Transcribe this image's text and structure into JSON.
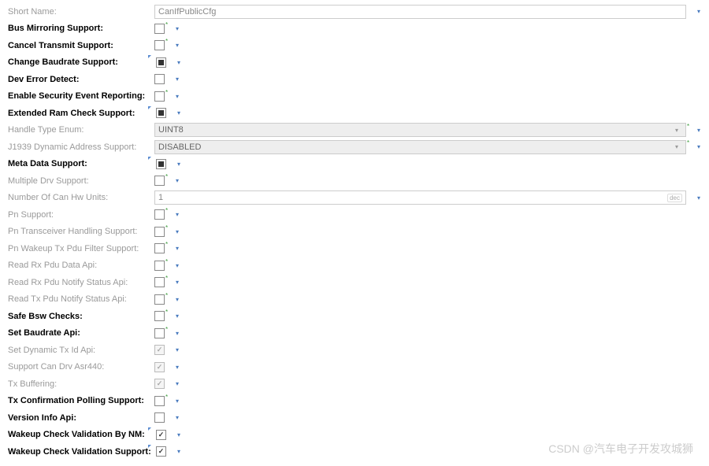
{
  "rows": [
    {
      "label": "Short Name:",
      "style": "muted",
      "type": "text",
      "value": "CanIfPublicCfg",
      "mark": "",
      "dd": true
    },
    {
      "label": "Bus Mirroring Support:",
      "style": "bold",
      "type": "chk",
      "state": "",
      "mark": "*",
      "dd": true
    },
    {
      "label": "Cancel Transmit Support:",
      "style": "bold",
      "type": "chk",
      "state": "",
      "mark": "*",
      "dd": true
    },
    {
      "label": "Change Baudrate Support:",
      "style": "bold",
      "type": "chk",
      "state": "partial",
      "mark": "",
      "corner": true,
      "dd": true
    },
    {
      "label": "Dev Error Detect:",
      "style": "bold",
      "type": "chk",
      "state": "",
      "mark": "",
      "dd": true
    },
    {
      "label": "Enable Security Event Reporting:",
      "style": "bold",
      "type": "chk",
      "state": "",
      "mark": "*",
      "dd": true
    },
    {
      "label": "Extended Ram Check Support:",
      "style": "bold",
      "type": "chk",
      "state": "partial",
      "mark": "",
      "corner": true,
      "dd": true
    },
    {
      "label": "Handle Type Enum:",
      "style": "muted",
      "type": "select",
      "value": "UINT8",
      "mark": "*",
      "dd": true
    },
    {
      "label": "J1939 Dynamic Address Support:",
      "style": "muted",
      "type": "select",
      "value": "DISABLED",
      "mark": "*",
      "dd": true
    },
    {
      "label": "Meta Data Support:",
      "style": "bold",
      "type": "chk",
      "state": "partial",
      "mark": "",
      "corner": true,
      "dd": true
    },
    {
      "label": "Multiple Drv Support:",
      "style": "muted",
      "type": "chk",
      "state": "",
      "mark": "*",
      "dd": true
    },
    {
      "label": "Number Of Can Hw Units:",
      "style": "muted",
      "type": "num",
      "value": "1",
      "unit": "dec",
      "mark": "",
      "dd": true
    },
    {
      "label": "Pn Support:",
      "style": "muted",
      "type": "chk",
      "state": "",
      "mark": "*",
      "dd": true
    },
    {
      "label": "Pn Transceiver Handling Support:",
      "style": "muted",
      "type": "chk",
      "state": "",
      "mark": "*",
      "dd": true
    },
    {
      "label": "Pn Wakeup Tx Pdu Filter Support:",
      "style": "muted",
      "type": "chk",
      "state": "",
      "mark": "*",
      "dd": true
    },
    {
      "label": "Read Rx Pdu Data Api:",
      "style": "muted",
      "type": "chk",
      "state": "",
      "mark": "*",
      "dd": true
    },
    {
      "label": "Read Rx Pdu Notify Status Api:",
      "style": "muted",
      "type": "chk",
      "state": "",
      "mark": "*",
      "dd": true
    },
    {
      "label": "Read Tx Pdu Notify Status Api:",
      "style": "muted",
      "type": "chk",
      "state": "",
      "mark": "*",
      "dd": true
    },
    {
      "label": "Safe Bsw Checks:",
      "style": "bold",
      "type": "chk",
      "state": "",
      "mark": "*",
      "dd": true
    },
    {
      "label": "Set Baudrate Api:",
      "style": "bold",
      "type": "chk",
      "state": "",
      "mark": "*",
      "dd": true
    },
    {
      "label": "Set Dynamic Tx Id Api:",
      "style": "muted",
      "type": "chk",
      "state": "checked disabled",
      "mark": "",
      "dd": true
    },
    {
      "label": "Support Can Drv Asr440:",
      "style": "muted",
      "type": "chk",
      "state": "checked disabled",
      "mark": "",
      "dd": true
    },
    {
      "label": "Tx Buffering:",
      "style": "muted",
      "type": "chk",
      "state": "checked disabled",
      "mark": "",
      "dd": true
    },
    {
      "label": "Tx Confirmation Polling Support:",
      "style": "bold",
      "type": "chk",
      "state": "",
      "mark": "*",
      "dd": true
    },
    {
      "label": "Version Info Api:",
      "style": "bold",
      "type": "chk",
      "state": "",
      "mark": "",
      "dd": true
    },
    {
      "label": "Wakeup Check Validation By NM:",
      "style": "bold",
      "type": "chk",
      "state": "checked",
      "mark": "",
      "corner": true,
      "dd": true
    },
    {
      "label": "Wakeup Check Validation Support:",
      "style": "bold",
      "type": "chk",
      "state": "checked",
      "mark": "",
      "corner": true,
      "dd": true
    }
  ],
  "watermark": "CSDN @汽车电子开发攻城狮",
  "glyphs": {
    "dd": "▾"
  }
}
